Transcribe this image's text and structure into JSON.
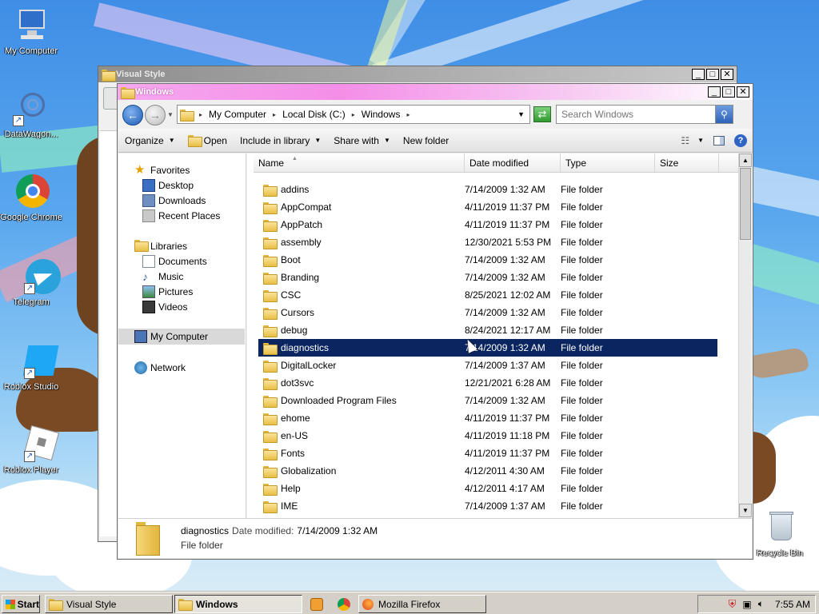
{
  "desktop": {
    "icons": [
      {
        "label": "My Computer",
        "icon": "computer-icon"
      },
      {
        "label": "DataWagon...",
        "icon": "datawagon-icon"
      },
      {
        "label": "Google Chrome",
        "icon": "chrome-icon"
      },
      {
        "label": "Telegram",
        "icon": "telegram-icon"
      },
      {
        "label": "Roblox Studio",
        "icon": "roblox-studio-icon"
      },
      {
        "label": "Roblox Player",
        "icon": "roblox-player-icon"
      },
      {
        "label": "Recycle Bin",
        "icon": "recycle-bin-icon"
      }
    ]
  },
  "background_window": {
    "title": "Visual Style",
    "controls": {
      "minimize": "_",
      "maximize": "□",
      "close": "✕"
    }
  },
  "explorer": {
    "title": "Windows",
    "controls": {
      "minimize": "_",
      "maximize": "□",
      "close": "✕"
    },
    "address": {
      "breadcrumbs": [
        "My Computer",
        "Local Disk (C:)",
        "Windows"
      ]
    },
    "search": {
      "placeholder": "Search Windows"
    },
    "toolbar": {
      "organize": "Organize",
      "open": "Open",
      "include_in_library": "Include in library",
      "share_with": "Share with",
      "new_folder": "New folder"
    },
    "nav": {
      "favorites": {
        "label": "Favorites",
        "items": [
          "Desktop",
          "Downloads",
          "Recent Places"
        ]
      },
      "libraries": {
        "label": "Libraries",
        "items": [
          "Documents",
          "Music",
          "Pictures",
          "Videos"
        ]
      },
      "computer": "My Computer",
      "network": "Network"
    },
    "columns": {
      "name": "Name",
      "date": "Date modified",
      "type": "Type",
      "size": "Size"
    },
    "files": [
      {
        "name": "addins",
        "date": "7/14/2009 1:32 AM",
        "type": "File folder"
      },
      {
        "name": "AppCompat",
        "date": "4/11/2019 11:37 PM",
        "type": "File folder"
      },
      {
        "name": "AppPatch",
        "date": "4/11/2019 11:37 PM",
        "type": "File folder"
      },
      {
        "name": "assembly",
        "date": "12/30/2021 5:53 PM",
        "type": "File folder"
      },
      {
        "name": "Boot",
        "date": "7/14/2009 1:32 AM",
        "type": "File folder"
      },
      {
        "name": "Branding",
        "date": "7/14/2009 1:32 AM",
        "type": "File folder"
      },
      {
        "name": "CSC",
        "date": "8/25/2021 12:02 AM",
        "type": "File folder"
      },
      {
        "name": "Cursors",
        "date": "7/14/2009 1:32 AM",
        "type": "File folder"
      },
      {
        "name": "debug",
        "date": "8/24/2021 12:17 AM",
        "type": "File folder"
      },
      {
        "name": "diagnostics",
        "date": "7/14/2009 1:32 AM",
        "type": "File folder",
        "selected": true
      },
      {
        "name": "DigitalLocker",
        "date": "7/14/2009 1:37 AM",
        "type": "File folder"
      },
      {
        "name": "dot3svc",
        "date": "12/21/2021 6:28 AM",
        "type": "File folder"
      },
      {
        "name": "Downloaded Program Files",
        "date": "7/14/2009 1:32 AM",
        "type": "File folder"
      },
      {
        "name": "ehome",
        "date": "4/11/2019 11:37 PM",
        "type": "File folder"
      },
      {
        "name": "en-US",
        "date": "4/11/2019 11:18 PM",
        "type": "File folder"
      },
      {
        "name": "Fonts",
        "date": "4/11/2019 11:37 PM",
        "type": "File folder"
      },
      {
        "name": "Globalization",
        "date": "4/12/2011 4:30 AM",
        "type": "File folder"
      },
      {
        "name": "Help",
        "date": "4/12/2011 4:17 AM",
        "type": "File folder"
      },
      {
        "name": "IME",
        "date": "7/14/2009 1:37 AM",
        "type": "File folder"
      }
    ],
    "details": {
      "name": "diagnostics",
      "date_label": "Date modified:",
      "date_value": "7/14/2009 1:32 AM",
      "type": "File folder"
    }
  },
  "taskbar": {
    "start": "Start",
    "tasks": [
      {
        "label": "Visual Style",
        "active": false
      },
      {
        "label": "Windows",
        "active": true
      },
      {
        "label": "Mozilla Firefox",
        "active": false
      }
    ],
    "clock": "7:55 AM"
  },
  "colors": {
    "selection": "#0b2560",
    "desktop_top": "#3f8ee6"
  }
}
